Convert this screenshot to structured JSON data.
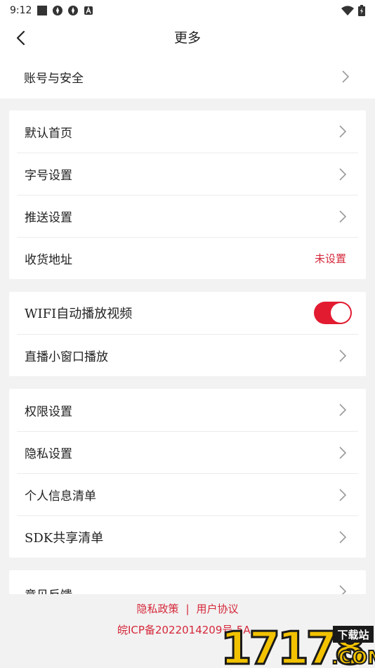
{
  "status_bar": {
    "time": "9:12"
  },
  "header": {
    "title": "更多"
  },
  "account_row": {
    "label": "账号与安全"
  },
  "section1": [
    {
      "label": "默认首页"
    },
    {
      "label": "字号设置"
    },
    {
      "label": "推送设置"
    },
    {
      "label": "收货地址",
      "status": "未设置"
    }
  ],
  "section2": {
    "wifi_label": "WIFI自动播放视频",
    "wifi_enabled": true,
    "live_label": "直播小窗口播放"
  },
  "section3": [
    {
      "label": "权限设置"
    },
    {
      "label": "隐私设置"
    },
    {
      "label": "个人信息清单"
    },
    {
      "label": "SDK共享清单"
    }
  ],
  "section4": [
    {
      "label": "意见反馈"
    }
  ],
  "footer": {
    "privacy_policy": "隐私政策",
    "separator": "|",
    "user_agreement": "用户协议",
    "icp": "皖ICP备2022014209号-5A"
  },
  "watermark": {
    "text": "17178",
    "badge": "下载站",
    "domain": ".COM"
  },
  "colors": {
    "accent": "#e21b31",
    "link": "#d5283a",
    "background": "#f2f2f2"
  }
}
